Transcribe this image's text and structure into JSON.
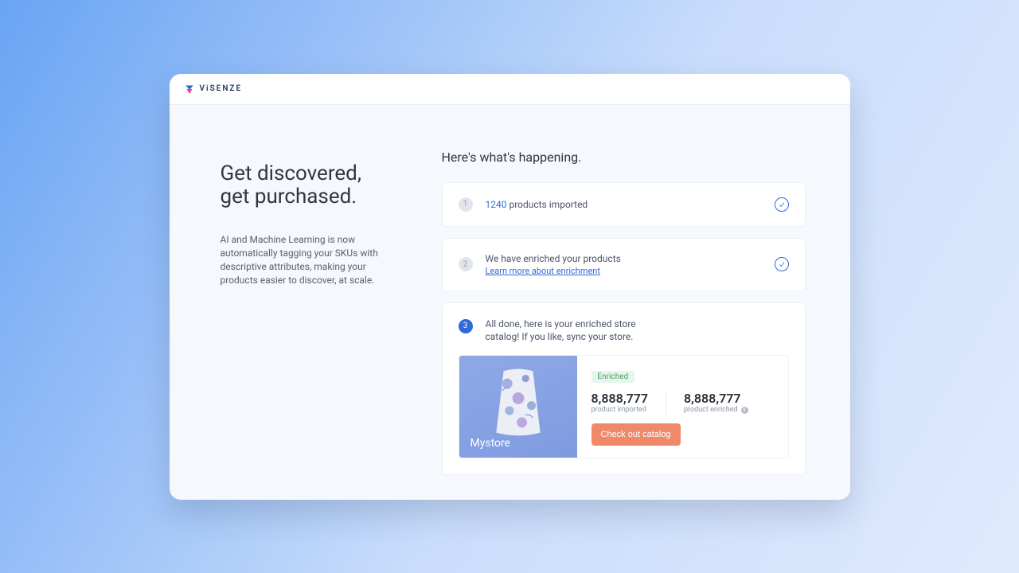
{
  "brand": {
    "name": "ViSENZE"
  },
  "left": {
    "headline_l1": "Get discovered,",
    "headline_l2": "get purchased.",
    "subtext": "AI and Machine Learning is now automatically tagging your SKUs with descriptive attributes, making your products easier to discover, at scale."
  },
  "right": {
    "title": "Here's what's happening.",
    "step1": {
      "num": "1",
      "count": "1240",
      "label": "products imported"
    },
    "step2": {
      "num": "2",
      "text": "We have enriched your products",
      "link": "Learn more about enrichment"
    },
    "step3": {
      "num": "3",
      "text": "All done, here is your enriched store catalog! If you like, sync your store."
    },
    "store": {
      "name": "Mystore",
      "badge": "Enriched",
      "stat1_value": "8,888,777",
      "stat1_label": "product imported",
      "stat2_value": "8,888,777",
      "stat2_label": "product enriched",
      "cta": "Check out catalog"
    }
  }
}
